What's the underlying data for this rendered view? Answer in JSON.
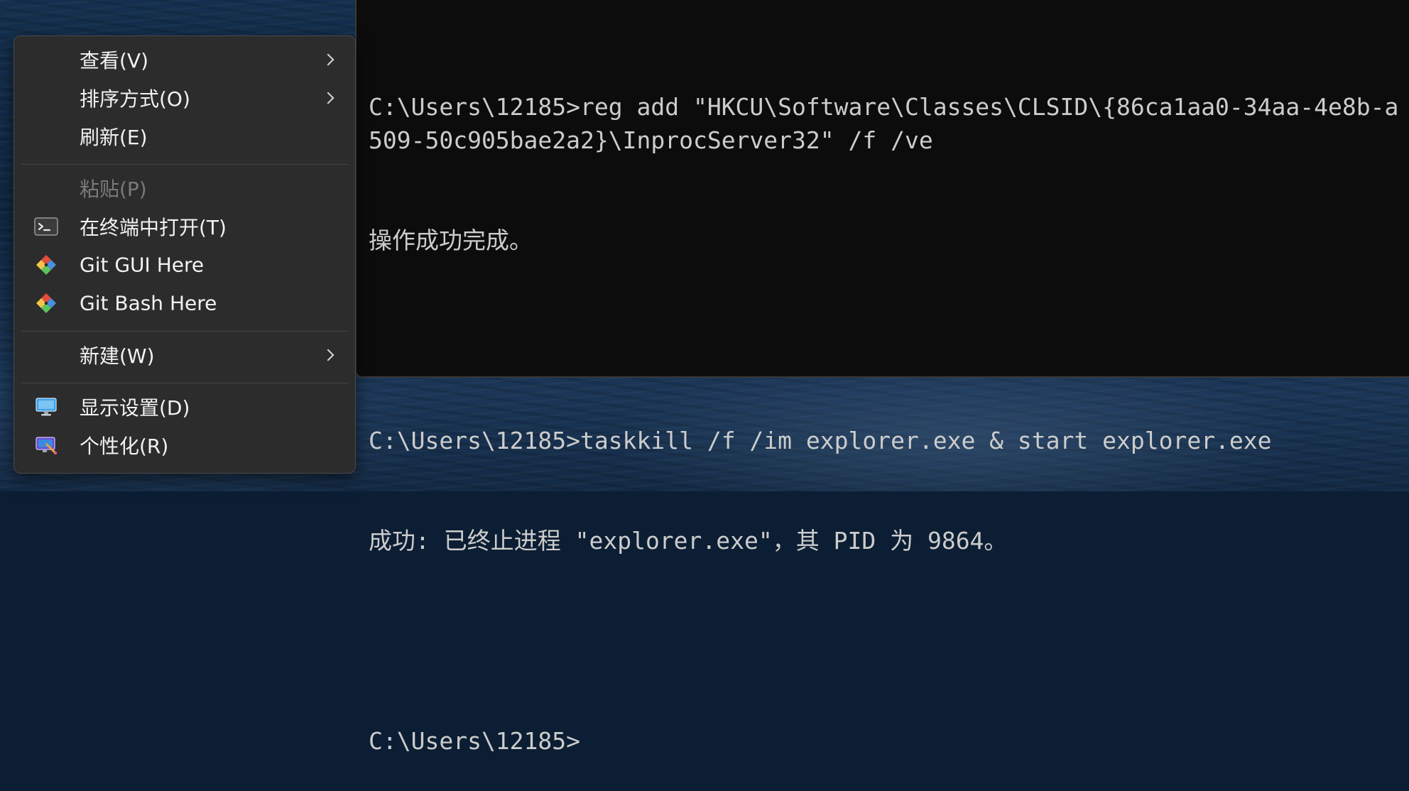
{
  "terminal": {
    "lines": [
      "C:\\Users\\12185>reg add \"HKCU\\Software\\Classes\\CLSID\\{86ca1aa0-34aa-4e8b-a509-50c905bae2a2}\\InprocServer32\" /f /ve",
      "操作成功完成。",
      "",
      "C:\\Users\\12185>taskkill /f /im explorer.exe & start explorer.exe",
      "成功: 已终止进程 \"explorer.exe\"，其 PID 为 9864。",
      "",
      "C:\\Users\\12185>"
    ]
  },
  "context_menu": {
    "items": [
      {
        "label": "查看(V)",
        "icon": null,
        "has_submenu": true,
        "disabled": false
      },
      {
        "label": "排序方式(O)",
        "icon": null,
        "has_submenu": true,
        "disabled": false
      },
      {
        "label": "刷新(E)",
        "icon": null,
        "has_submenu": false,
        "disabled": false
      },
      {
        "label": "粘贴(P)",
        "icon": null,
        "has_submenu": false,
        "disabled": true
      },
      {
        "label": "在终端中打开(T)",
        "icon": "terminal-icon",
        "has_submenu": false,
        "disabled": false
      },
      {
        "label": "Git GUI Here",
        "icon": "git-icon",
        "has_submenu": false,
        "disabled": false
      },
      {
        "label": "Git Bash Here",
        "icon": "git-icon",
        "has_submenu": false,
        "disabled": false
      },
      {
        "label": "新建(W)",
        "icon": null,
        "has_submenu": true,
        "disabled": false
      },
      {
        "label": "显示设置(D)",
        "icon": "display-settings-icon",
        "has_submenu": false,
        "disabled": false
      },
      {
        "label": "个性化(R)",
        "icon": "personalize-icon",
        "has_submenu": false,
        "disabled": false
      }
    ]
  },
  "colors": {
    "terminal_bg": "#0c0c0c",
    "terminal_text": "#cccccc",
    "menu_bg": "#2c2c2c",
    "menu_text": "#f2f2f2",
    "menu_disabled_text": "#7a7a7a"
  }
}
